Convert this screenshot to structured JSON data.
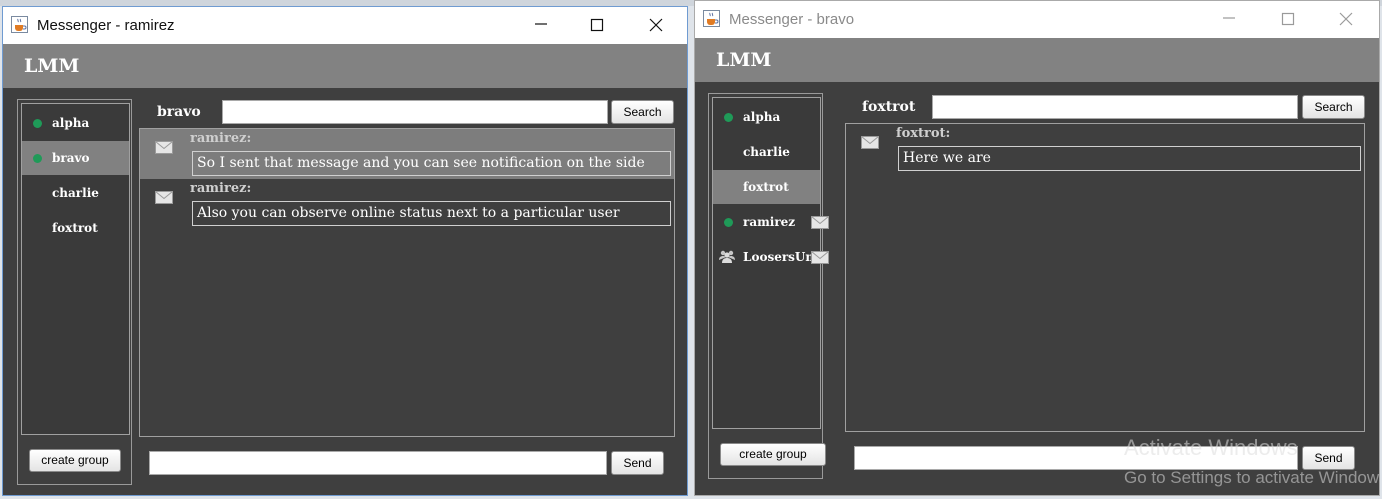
{
  "windows": [
    {
      "title": "Messenger - ramirez",
      "brand": "LMM",
      "users": [
        {
          "label": "alpha",
          "online": true,
          "selected": false,
          "group": false,
          "notification": false
        },
        {
          "label": "bravo",
          "online": true,
          "selected": true,
          "group": false,
          "notification": false
        },
        {
          "label": "charlie",
          "online": false,
          "selected": false,
          "group": false,
          "notification": false
        },
        {
          "label": "foxtrot",
          "online": false,
          "selected": false,
          "group": false,
          "notification": false
        }
      ],
      "create_group_label": "create group",
      "chat_partner": "bravo",
      "search_value": "",
      "search_label": "Search",
      "messages": [
        {
          "sender": "ramirez:",
          "text": "So I sent that message and you can see notification on the side",
          "highlighted": true
        },
        {
          "sender": "ramirez:",
          "text": "Also you can observe online status next to a particular user",
          "highlighted": false
        }
      ],
      "compose_value": "",
      "send_label": "Send"
    },
    {
      "title": "Messenger - bravo",
      "brand": "LMM",
      "users": [
        {
          "label": "alpha",
          "online": true,
          "selected": false,
          "group": false,
          "notification": false
        },
        {
          "label": "charlie",
          "online": false,
          "selected": false,
          "group": false,
          "notification": false
        },
        {
          "label": "foxtrot",
          "online": false,
          "selected": true,
          "group": false,
          "notification": false
        },
        {
          "label": "ramirez",
          "online": true,
          "selected": false,
          "group": false,
          "notification": true
        },
        {
          "label": "LoosersUnit",
          "online": false,
          "selected": false,
          "group": true,
          "notification": true
        }
      ],
      "create_group_label": "create group",
      "chat_partner": "foxtrot",
      "search_value": "",
      "search_label": "Search",
      "messages": [
        {
          "sender": "foxtrot:",
          "text": "Here we are",
          "highlighted": false
        }
      ],
      "compose_value": "",
      "send_label": "Send"
    }
  ],
  "watermark": {
    "line1": "Activate Windows",
    "line2": "Go to Settings to activate Windows."
  },
  "colors": {
    "panel_bg": "#3f3f3f",
    "header_bg": "#828282",
    "selected_bg": "#818181",
    "online_dot": "#1f9a58"
  },
  "icons": {
    "app": "java-cup-icon",
    "notification": "envelope-icon",
    "group": "group-icon"
  }
}
